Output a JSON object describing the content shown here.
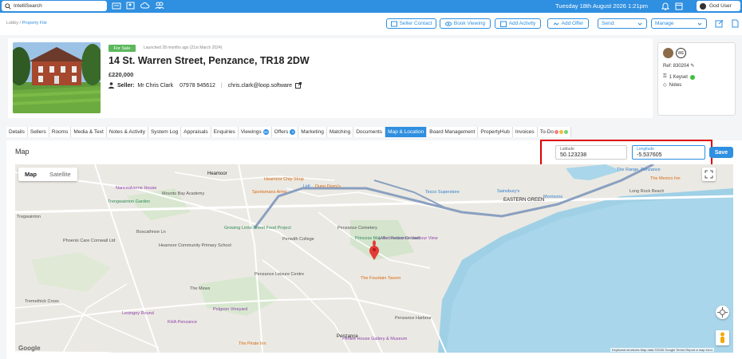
{
  "topbar": {
    "search_placeholder": "IntelliSearch",
    "date": "Tuesday 18th August 2026 1:21pm",
    "user": "God User",
    "bg_color": "#2f8fe0"
  },
  "breadcrumb": {
    "root": "Lobby",
    "sep": "/",
    "current": "Property File"
  },
  "actions": {
    "seller_contact": "Seller Contact",
    "book_viewing": "Book Viewing",
    "add_activity": "Add Activity",
    "add_offer": "Add Offer",
    "send": "Send:",
    "manage": "Manage"
  },
  "property": {
    "status": "For Sale",
    "launched": "Launched 28 months ago (21st March 2024)",
    "address": "14 St. Warren Street, Penzance, TR18 2DW",
    "price": "£220,000",
    "seller_label": "Seller:",
    "seller_name": "Mr Chris Clark",
    "phone": "07978 945612",
    "email": "chris.clark@loop.software"
  },
  "side_panel": {
    "initials": "WE",
    "ref": "Ref: 830204",
    "keys": "1 Keyset",
    "notes": "Notes"
  },
  "tabs": [
    {
      "label": "Details"
    },
    {
      "label": "Sellers"
    },
    {
      "label": "Rooms"
    },
    {
      "label": "Media & Text"
    },
    {
      "label": "Notes & Activity"
    },
    {
      "label": "System Log"
    },
    {
      "label": "Appraisals"
    },
    {
      "label": "Enquiries"
    },
    {
      "label": "Viewings",
      "badge": "16"
    },
    {
      "label": "Offers",
      "badge": "3"
    },
    {
      "label": "Marketing"
    },
    {
      "label": "Matching"
    },
    {
      "label": "Documents"
    },
    {
      "label": "Map & Location",
      "active": true
    },
    {
      "label": "Board Management"
    },
    {
      "label": "PropertyHub"
    },
    {
      "label": "Invoices"
    },
    {
      "label": "To-Do",
      "pills": [
        "#f08080",
        "#f0c040",
        "#7bd17b"
      ]
    }
  ],
  "map_section": {
    "title": "Map",
    "latitude_label": "Latitude",
    "latitude_value": "50.123238",
    "longitude_label": "Longitude",
    "longitude_value": "-5.537605",
    "save_label": "Save",
    "map_tab": "Map",
    "satellite_tab": "Satellite",
    "google": "Google",
    "attribution": "Keyboard shortcuts   Map data ©2026 Google   Terms   Report a map error"
  },
  "map_labels": [
    "Heamoor",
    "Nancealverne House",
    "Mounts Bay Academy",
    "Trengwainton Garden",
    "Heamoor Chip Shop",
    "Sportsmans Arms",
    "Lidl",
    "Dunn Dorry's",
    "Tesco Superstore",
    "Sainsbury's",
    "The Range, Penzance",
    "The Mexico Inn",
    "Long Rock Beach",
    "Morrisons",
    "Penwith College",
    "Penzance Cemetery",
    "Princess May Recreation Ground",
    "Hotel Penzance Harbour View",
    "Penzance Leisure Centre",
    "The Fountain Tavern",
    "EASTERN GREEN",
    "Boscathnoe Ln",
    "Heamoor Community Primary School",
    "Growing Links Street Food Project",
    "Phoenix Care Cornwall Ltd",
    "Tregwainton",
    "The Mews",
    "Polgoon Vineyard",
    "Lesingey Round",
    "KHA Penzance",
    "Tremethick Cross",
    "Penzance",
    "The Pirate Inn",
    "Penlee House Gallery & Museum",
    "Penzance Harbour",
    "A30",
    "A3071",
    "B3312",
    "B3311"
  ]
}
